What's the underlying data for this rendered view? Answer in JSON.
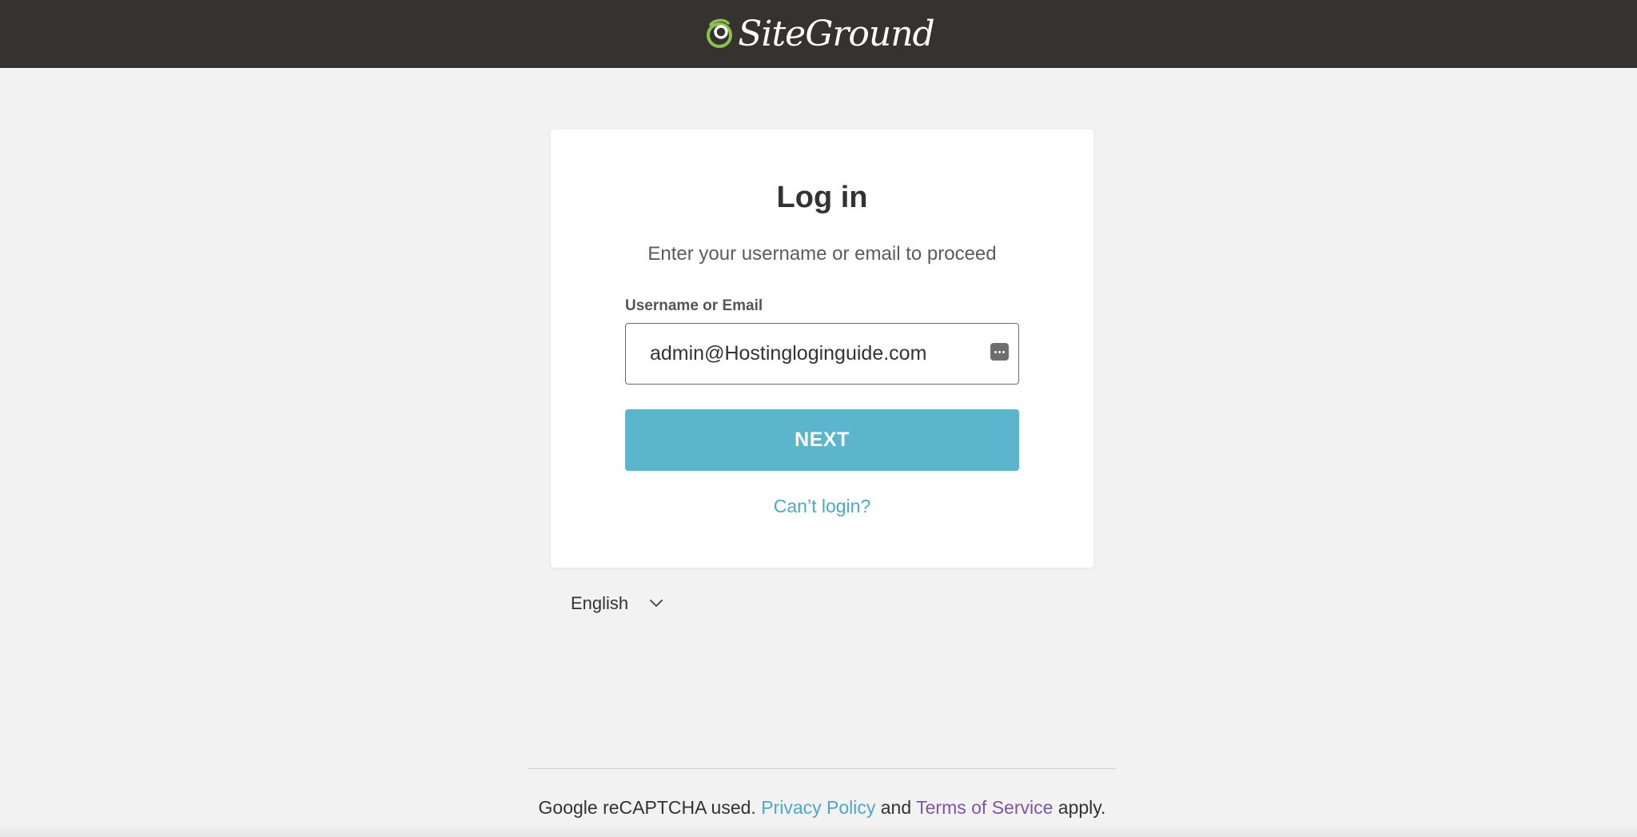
{
  "header": {
    "brand": "SiteGround",
    "background_color": "#343331",
    "logo_accent_color": "#8bc34a"
  },
  "login": {
    "title": "Log in",
    "subtitle": "Enter your username or email to proceed",
    "field_label": "Username or Email",
    "field_value": "admin@Hostingloginguide.com",
    "next_label": "NEXT",
    "cant_login_label": "Can’t login?",
    "button_color": "#5bb5cd",
    "link_color": "#4ba9c5"
  },
  "language": {
    "selected": "English"
  },
  "footer": {
    "prefix": "Google reCAPTCHA used.",
    "privacy_label": "Privacy Policy",
    "and_label": "and",
    "terms_label": "Terms of Service",
    "suffix": "apply."
  }
}
